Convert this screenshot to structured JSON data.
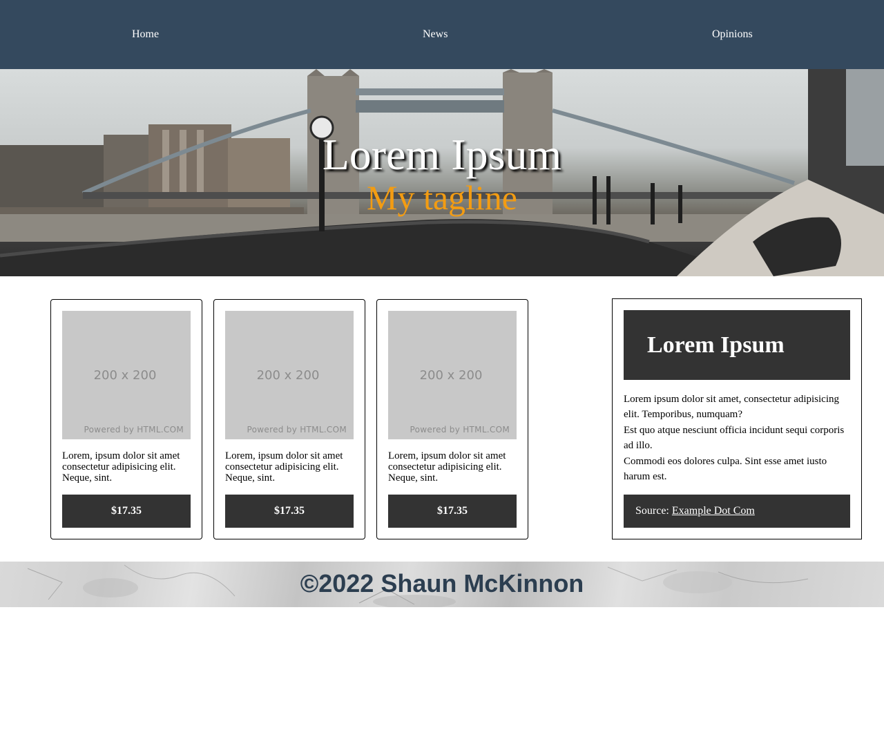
{
  "nav": {
    "items": [
      {
        "label": "Home"
      },
      {
        "label": "News"
      },
      {
        "label": "Opinions"
      }
    ]
  },
  "hero": {
    "title": "Lorem Ipsum",
    "tagline": "My tagline",
    "tagline_color": "#f39c12"
  },
  "cards": [
    {
      "image_size": "200 x 200",
      "image_credit": "Powered by HTML.COM",
      "text": "Lorem, ipsum dolor sit amet consectetur adipisicing elit. Neque, sint.",
      "price": "$17.35"
    },
    {
      "image_size": "200 x 200",
      "image_credit": "Powered by HTML.COM",
      "text": "Lorem, ipsum dolor sit amet consectetur adipisicing elit. Neque, sint.",
      "price": "$17.35"
    },
    {
      "image_size": "200 x 200",
      "image_credit": "Powered by HTML.COM",
      "text": "Lorem, ipsum dolor sit amet consectetur adipisicing elit. Neque, sint.",
      "price": "$17.35"
    }
  ],
  "sidebar": {
    "title": "Lorem Ipsum",
    "lines": [
      "Lorem ipsum dolor sit amet, consectetur adipisicing elit. Temporibus, numquam?",
      "Est quo atque nesciunt officia incidunt sequi corporis ad illo.",
      "Commodi eos dolores culpa. Sint esse amet iusto harum est."
    ],
    "source_label": "Source:",
    "source_link": "Example Dot Com"
  },
  "footer": {
    "text": "©2022 Shaun McKinnon",
    "text_color": "#2c3e50"
  },
  "colors": {
    "nav_bg": "#34495e",
    "dark_panel": "#333333",
    "placeholder_bg": "#c8c8c8"
  }
}
